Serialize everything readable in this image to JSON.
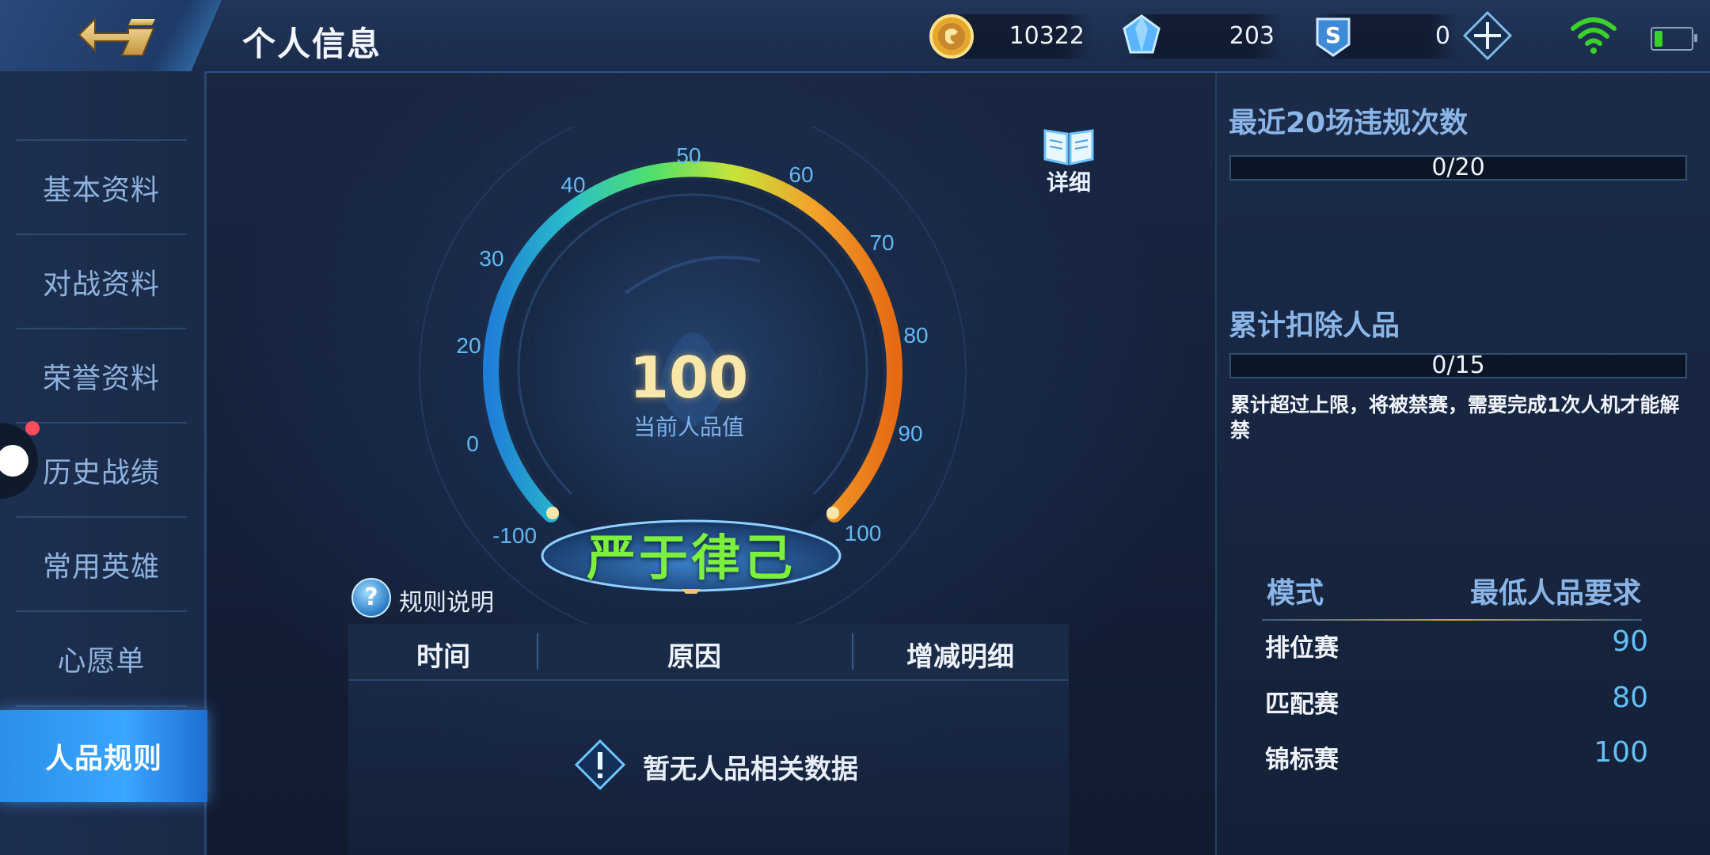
{
  "header": {
    "title": "个人信息",
    "back_icon": "back-arrow-icon",
    "currencies": [
      {
        "icon": "gold-coin-icon",
        "value": "10322"
      },
      {
        "icon": "diamond-icon",
        "value": "203"
      },
      {
        "icon": "voucher-icon",
        "value": "0"
      }
    ],
    "plus_icon": "plus-icon",
    "wifi_icon": "wifi-icon",
    "battery_icon": "battery-icon"
  },
  "sidebar": {
    "items": [
      {
        "label": "基本资料"
      },
      {
        "label": "对战资料"
      },
      {
        "label": "荣誉资料"
      },
      {
        "label": "历史战绩"
      },
      {
        "label": "常用英雄"
      },
      {
        "label": "心愿单"
      },
      {
        "label": "人品规则"
      }
    ],
    "active_index": 6
  },
  "gauge": {
    "ticks": [
      "-100",
      "0",
      "20",
      "30",
      "40",
      "50",
      "60",
      "70",
      "80",
      "90",
      "100"
    ],
    "value": "100",
    "value_label": "当前人品值",
    "rating": "严于律己",
    "details_label": "详细"
  },
  "rules": {
    "label": "规则说明"
  },
  "table": {
    "columns": [
      "时间",
      "原因",
      "增减明细"
    ],
    "empty_text": "暂无人品相关数据"
  },
  "right": {
    "violations_title": "最近20场违规次数",
    "violations_value": "0/20",
    "deduct_title": "累计扣除人品",
    "deduct_value": "0/15",
    "note": "累计超过上限，将被禁赛，需要完成1次人机才能解禁",
    "req_header_mode": "模式",
    "req_header_min": "最低人品要求",
    "requirements": [
      {
        "mode": "排位赛",
        "min": "90"
      },
      {
        "mode": "匹配赛",
        "min": "80"
      },
      {
        "mode": "锦标赛",
        "min": "100"
      }
    ]
  },
  "colors": {
    "accent": "#3aa6ff",
    "rating_green": "#7df03e",
    "score_gold": "#f8e7a8",
    "value_blue": "#63c0f5"
  }
}
